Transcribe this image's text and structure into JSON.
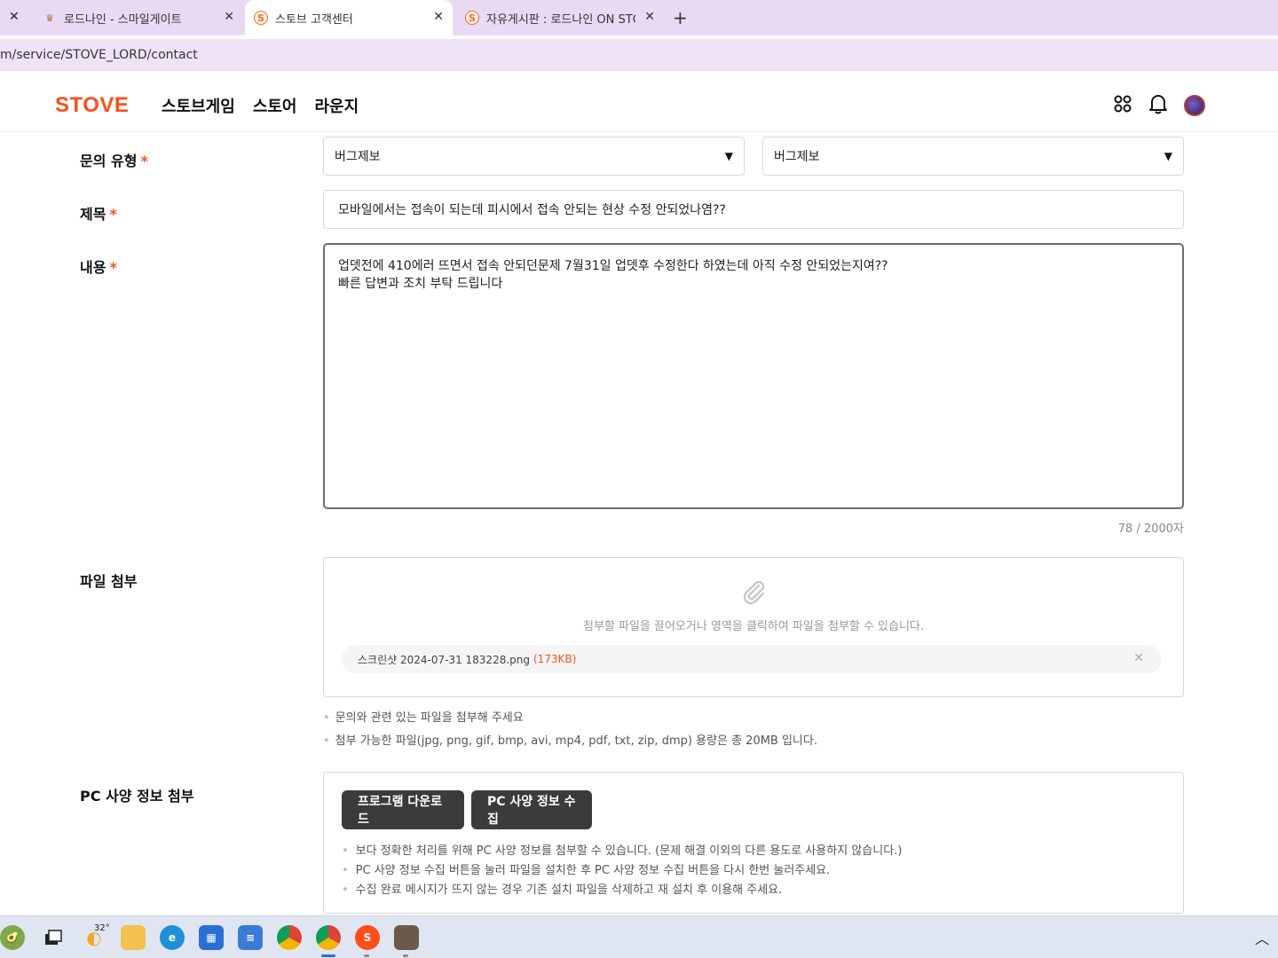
{
  "browser": {
    "tabs": [
      {
        "title": "로드나인 - 스마일게이트",
        "favicon": "lordnine-icon"
      },
      {
        "title": "스토브 고객센터",
        "favicon": "stove-s-icon"
      },
      {
        "title": "자유게시판 : 로드나인 ON STO",
        "favicon": "stove-s-icon"
      }
    ],
    "new_tab": "+",
    "address": "m/service/STOVE_LORD/contact"
  },
  "header": {
    "logo": "STOVE",
    "nav": [
      "스토브게임",
      "스토어",
      "라운지"
    ]
  },
  "form": {
    "type_label": "문의 유형",
    "required_mark": "*",
    "type_select_1": "버그제보",
    "type_select_2": "버그제보",
    "title_label": "제목",
    "title_value": "모바일에서는 접속이 되는데 피시에서 접속 안되는 현상 수정 안되었나염??",
    "content_label": "내용",
    "content_value": "업뎃전에 410에러 뜨면서 접속 안되던문제 7월31일 업뎃후 수정한다 하였는데 아직 수정 안되었는지여??\n빠른 답변과 조치 부탁 드립니다",
    "char_count": "78 / 2000자",
    "attach_label": "파일 첨부",
    "attach_hint": "첨부할 파일을 끌어오거나 영역을 클릭하여 파일을 첨부할 수 있습니다.",
    "file_name": "스크린샷 2024-07-31 183228.png",
    "file_size": "(173KB)",
    "attach_notes": [
      "문의와 관련 있는 파일을 첨부해 주세요",
      "첨부 가능한 파일(jpg, png, gif, bmp, avi, mp4, pdf, txt, zip, dmp) 용량은 총 20MB 입니다."
    ],
    "pc_label": "PC 사양 정보 첨부",
    "btn_download": "프로그램 다운로드",
    "btn_collect": "PC 사양 정보 수집",
    "pc_notes": [
      "보다 정확한 처리를 위해 PC 사양 정보를 첨부할 수 있습니다. (문제 해결 이외의 다른 용도로 사용하지 않습니다.)",
      "PC 사양 정보 수집 버튼을 눌러 파일을 설치한 후 PC 사양 정보 수집 버튼을 다시 한번 눌러주세요.",
      "수집 완료 메시지가 뜨지 않는 경우 기존 설치 파일을 삭제하고 재 설치 후 이용해 주세요."
    ]
  },
  "taskbar": {
    "weather_temp": "32°",
    "icons": [
      "widgets-icon",
      "task-view-icon",
      "weather-icon",
      "file-explorer-icon",
      "edge-icon",
      "store-icon",
      "notepad-icon",
      "chrome-icon",
      "chrome-active-icon",
      "stove-icon",
      "game-icon",
      "chevron-up-icon"
    ]
  },
  "colors": {
    "accent": "#ff4d1a",
    "dark_button": "#3b3b3b",
    "tabbar": "#e9d9f5"
  }
}
